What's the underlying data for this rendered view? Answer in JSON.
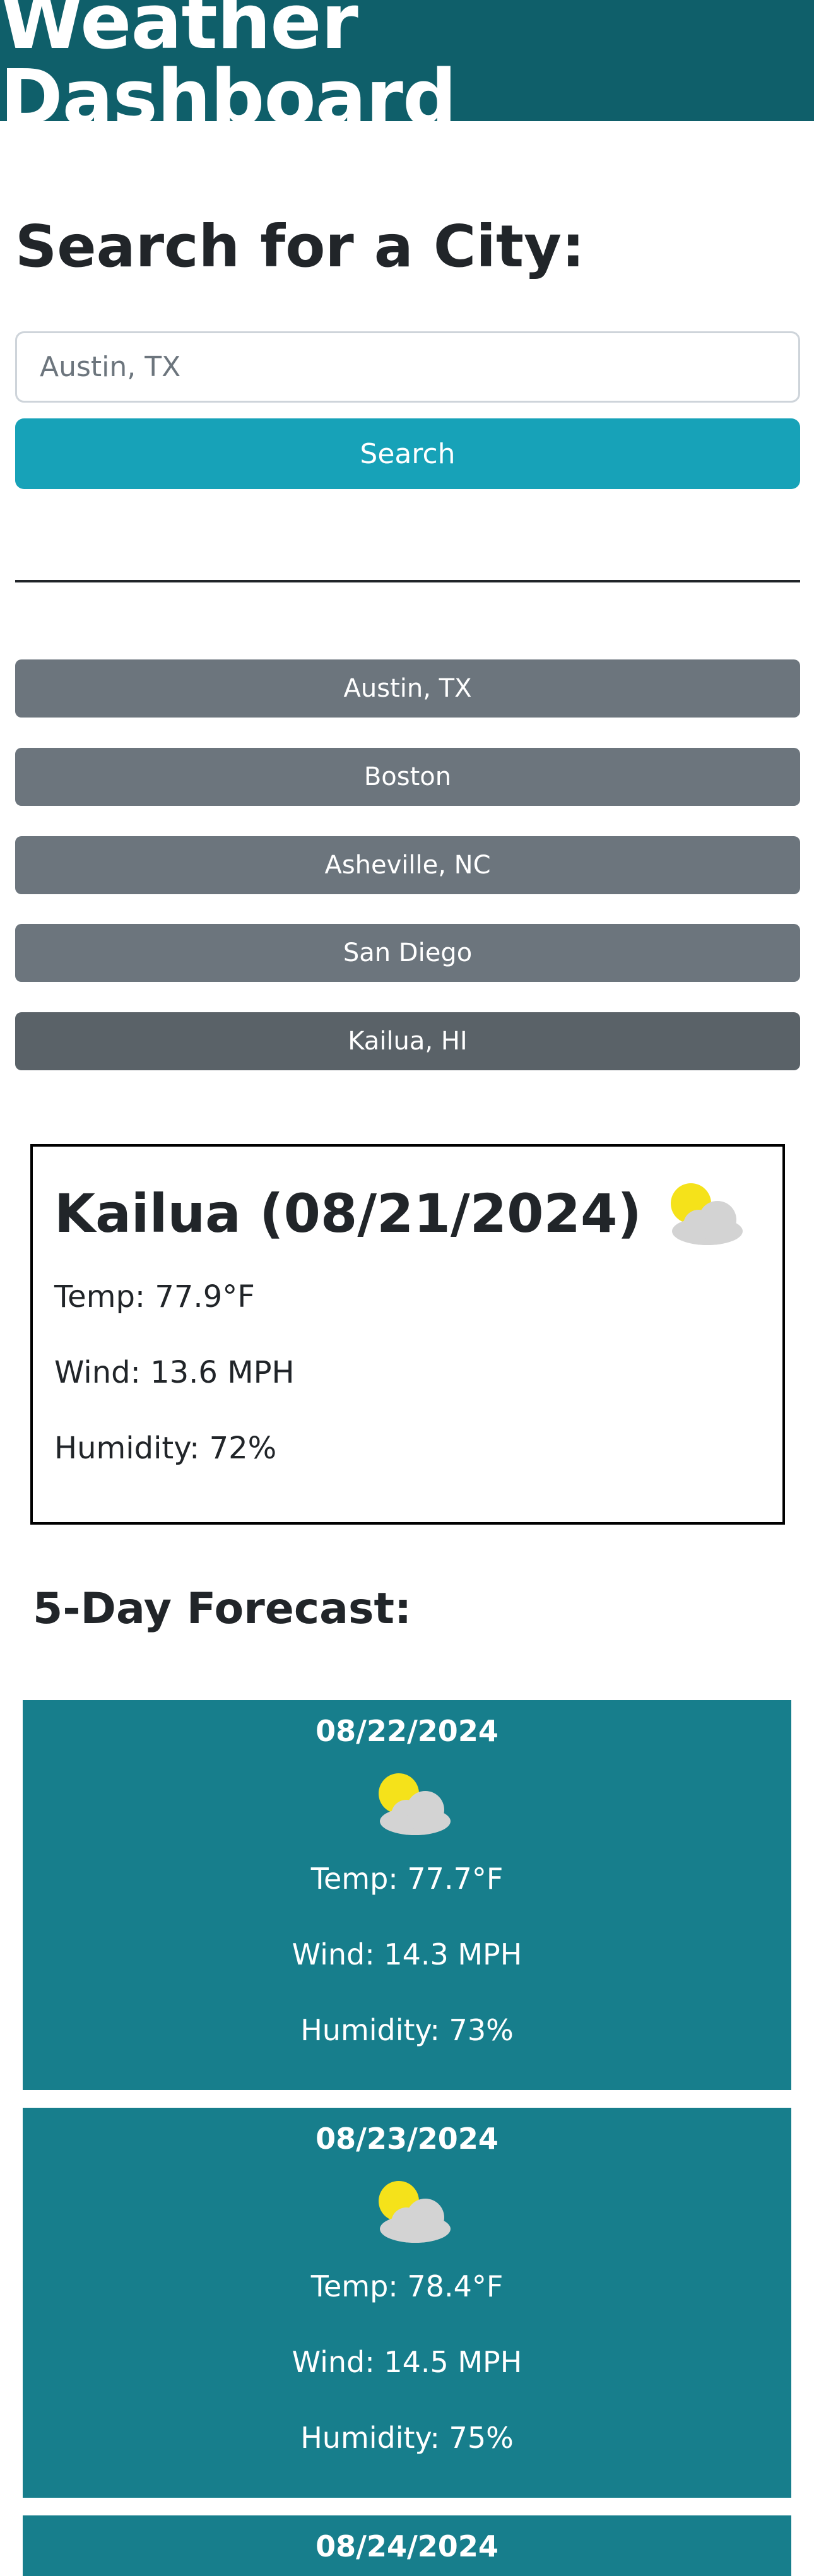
{
  "header": {
    "title": "Weather Dashboard"
  },
  "search": {
    "title": "Search for a City:",
    "placeholder": "Austin, TX",
    "button_label": "Search"
  },
  "history": [
    {
      "label": "Austin, TX"
    },
    {
      "label": "Boston"
    },
    {
      "label": "Asheville, NC"
    },
    {
      "label": "San Diego"
    },
    {
      "label": "Kailua, HI"
    }
  ],
  "current": {
    "title": "Kailua (08/21/2024)",
    "icon": "partly-cloudy-icon",
    "temp": "Temp: 77.9°F",
    "wind": "Wind: 13.6 MPH",
    "humidity": "Humidity: 72%"
  },
  "forecast": {
    "title": "5-Day Forecast:",
    "days": [
      {
        "date": "08/22/2024",
        "icon": "partly-cloudy-icon",
        "temp": "Temp: 77.7°F",
        "wind": "Wind: 14.3 MPH",
        "humidity": "Humidity: 73%"
      },
      {
        "date": "08/23/2024",
        "icon": "partly-cloudy-icon",
        "temp": "Temp: 78.4°F",
        "wind": "Wind: 14.5 MPH",
        "humidity": "Humidity: 75%"
      },
      {
        "date": "08/24/2024"
      }
    ]
  },
  "colors": {
    "header_bg": "#0f5f6a",
    "search_button": "#17a2b8",
    "history_button": "#6c757d",
    "forecast_card": "#177e8c"
  }
}
